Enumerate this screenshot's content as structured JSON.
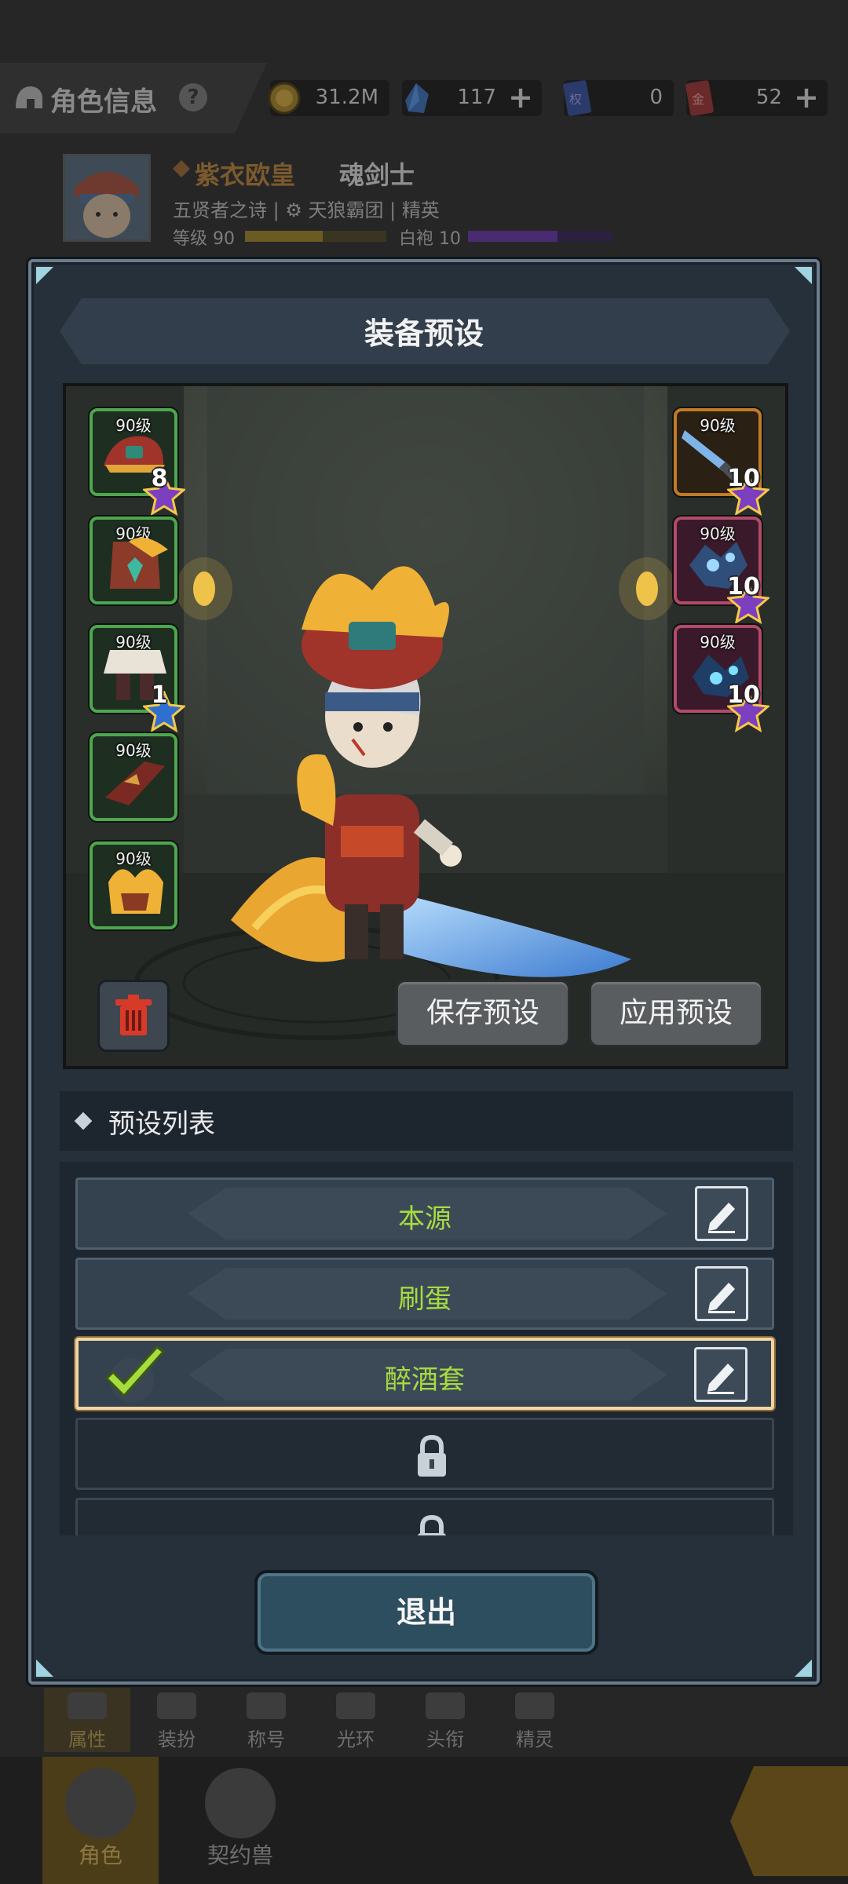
{
  "topbar": {
    "title": "角色信息",
    "help_icon": "?",
    "resources": [
      {
        "icon": "coin-icon",
        "value": "31.2M",
        "plus": ""
      },
      {
        "icon": "crystal-icon",
        "value": "117",
        "plus": "+"
      },
      {
        "icon": "ticket-blue-icon",
        "value": "0",
        "plus": ""
      },
      {
        "icon": "ticket-red-icon",
        "value": "52",
        "plus": "+"
      }
    ]
  },
  "profile": {
    "name": "紫衣欧皇",
    "class": "魂剑士",
    "line2": "五贤者之诗 | ⚙ 天狼霸团 | 精英",
    "level_label": "等级 90",
    "rank_label": "白袍 10",
    "level_progress": 0.55,
    "rank_progress": 0.62
  },
  "modal": {
    "title": "装备预设",
    "left_slots": [
      {
        "level": "90级",
        "badge": "8",
        "badge_color": "#7b3fc0",
        "frame": "green",
        "icon": "helmet-icon"
      },
      {
        "level": "90级",
        "badge": "",
        "frame": "green",
        "icon": "armor-icon"
      },
      {
        "level": "90级",
        "badge": "1",
        "badge_color": "#2f6fd0",
        "frame": "green",
        "icon": "skirt-icon"
      },
      {
        "level": "90级",
        "badge": "",
        "frame": "green",
        "icon": "gauntlet-icon"
      },
      {
        "level": "90级",
        "badge": "",
        "frame": "green",
        "icon": "boots-icon"
      }
    ],
    "right_slots": [
      {
        "level": "90级",
        "badge": "10",
        "badge_color": "#7b3fc0",
        "frame": "orange",
        "icon": "sword-icon"
      },
      {
        "level": "90级",
        "badge": "10",
        "badge_color": "#7b3fc0",
        "frame": "red",
        "icon": "gem-icon"
      },
      {
        "level": "90级",
        "badge": "10",
        "badge_color": "#7b3fc0",
        "frame": "red",
        "icon": "gem-icon"
      }
    ],
    "save_button": "保存预设",
    "apply_button": "应用预设",
    "section_title": "预设列表",
    "presets": [
      {
        "name": "本源",
        "state": "normal"
      },
      {
        "name": "刷蛋",
        "state": "normal"
      },
      {
        "name": "醉酒套",
        "state": "selected"
      },
      {
        "name": "",
        "state": "locked"
      },
      {
        "name": "",
        "state": "locked"
      }
    ],
    "exit_button": "退出"
  },
  "bottom_tabs": [
    "属性",
    "装扮",
    "称号",
    "光环",
    "头衔",
    "精灵"
  ],
  "nav": [
    "角色",
    "契约兽"
  ],
  "colors": {
    "accent_green": "#a7dc3f",
    "selected_border": "#f3d4a1",
    "modal_bg": "#26303b"
  }
}
